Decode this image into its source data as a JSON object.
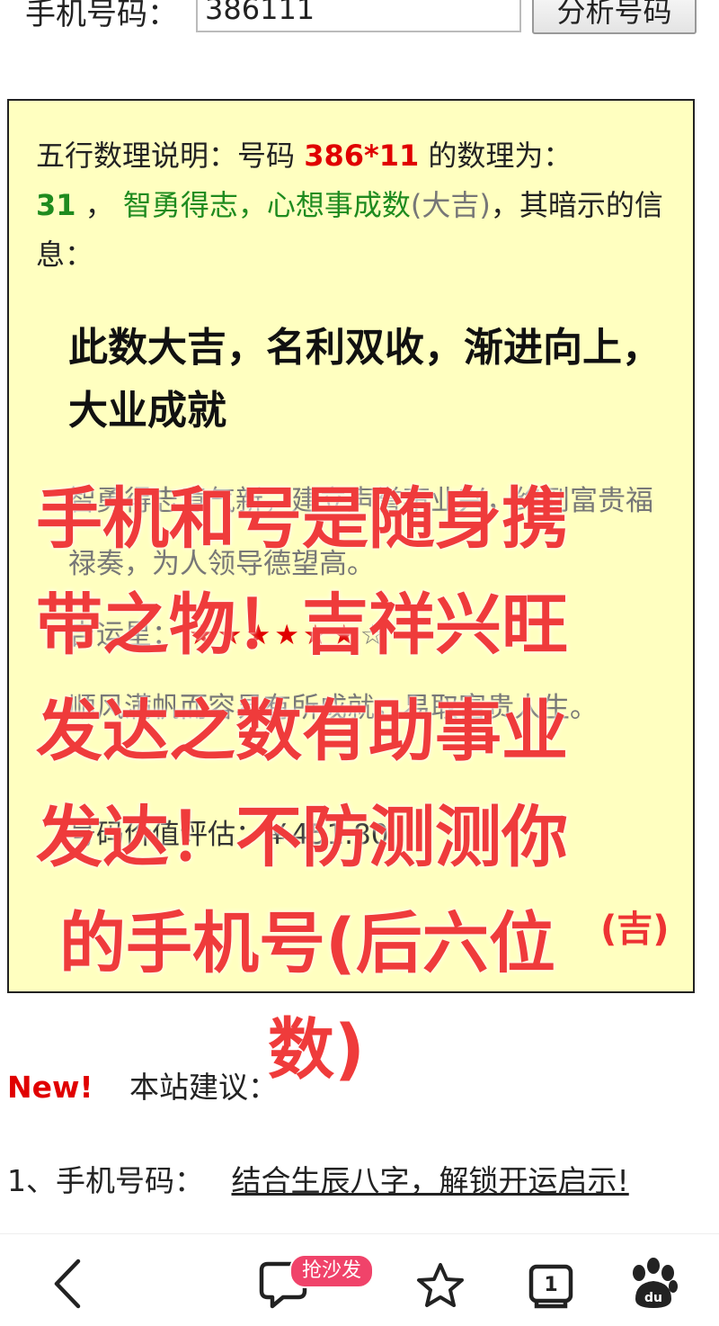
{
  "search": {
    "label": "手机号码：",
    "value": "386111",
    "button": "分析号码"
  },
  "result": {
    "intro_prefix": "五行数理说明：号码",
    "masked_number": "386*11",
    "intro_mid": "的数理为：",
    "score": "31",
    "comma1": "，",
    "score_title": "智勇得志，心想事成数",
    "rating": "(大吉)",
    "intro_suffix": "，其暗示的信息：",
    "headline": "此数大吉，名利双收，渐进向上，大业成就",
    "poem": "智勇得志意气新，建立声誉事业兴，终到富贵福禄奏，为人领导德望高。",
    "luck_label": "吉运星：",
    "luck_stars_filled": "★★★★★★",
    "luck_stars_empty": "☆",
    "luck_desc": "顺风满帆而容易有所成就，易取富贵人生。",
    "value_text": "号码价值评估：￥451.80",
    "ji_tag": "(吉)"
  },
  "overlay": {
    "lines": [
      "手机和号是随身携",
      "带之物！吉祥兴旺",
      "发达之数有助事业",
      "发达！不防测测你",
      "的手机号(后六位",
      "数)"
    ]
  },
  "suggest": {
    "new_label": "New!",
    "title": "本站建议：",
    "item1_prefix": "1、手机号码：",
    "item1_link": "结合生辰八字，解锁开运启示!"
  },
  "nav": {
    "badge": "抢沙发",
    "tab_count": "1"
  },
  "colors": {
    "box_bg": "#ffffc0",
    "accent_red": "#e00000",
    "overlay_red": "#ef3b3b",
    "green": "#1f8b1f",
    "badge_pink": "#f0436a"
  }
}
